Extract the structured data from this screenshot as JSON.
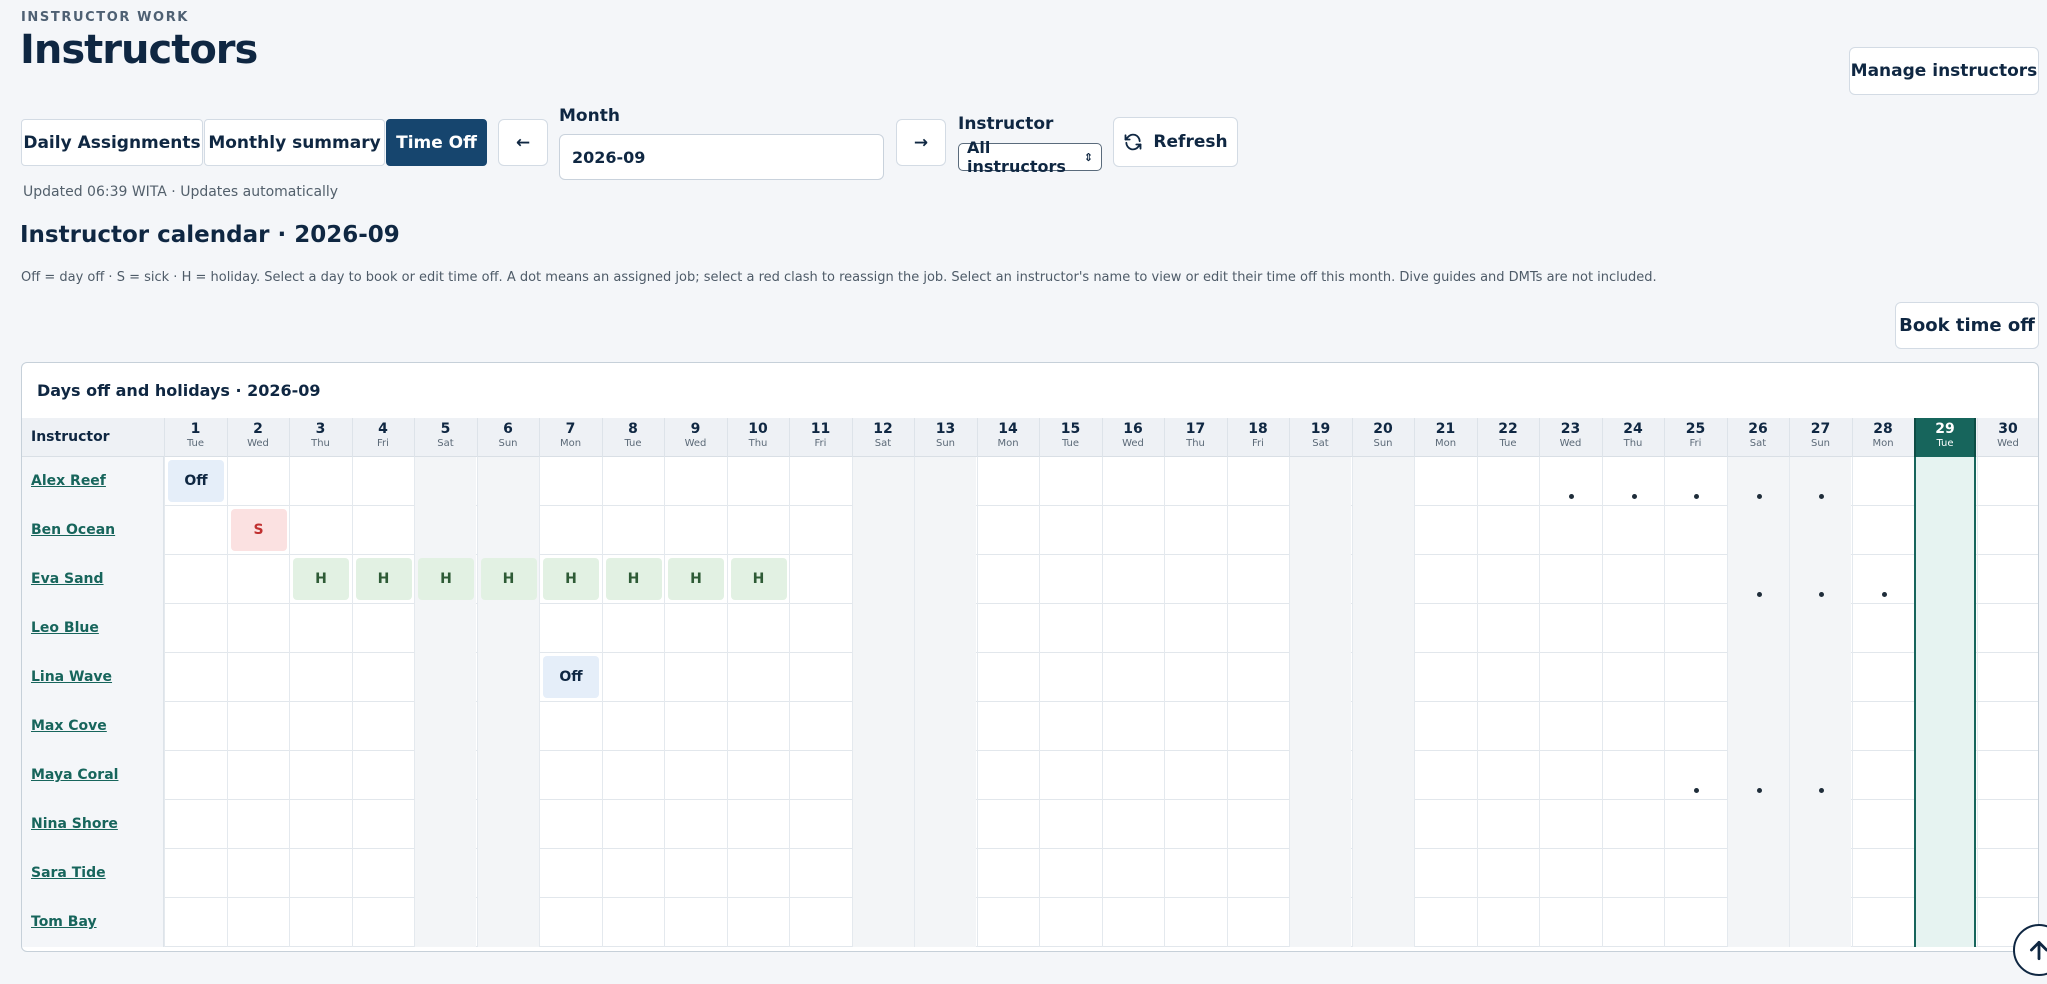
{
  "header": {
    "eyebrow": "INSTRUCTOR WORK",
    "title": "Instructors",
    "manage_label": "Manage instructors"
  },
  "tabs": [
    {
      "label": "Daily Assignments",
      "active": false
    },
    {
      "label": "Monthly summary",
      "active": false
    },
    {
      "label": "Time Off",
      "active": true
    }
  ],
  "controls": {
    "prev_label": "←",
    "next_label": "→",
    "month_label": "Month",
    "month_value": "2026-09",
    "instructor_label": "Instructor",
    "instructor_value": "All instructors",
    "refresh_label": "Refresh"
  },
  "updated_text": "Updated 06:39 WITA · Updates automatically",
  "calendar_title": "Instructor calendar · 2026-09",
  "legend_text": "Off = day off · S = sick · H = holiday. Select a day to book or edit time off. A dot means an assigned job; select a red clash to reassign the job. Select an instructor's name to view or edit their time off this month. Dive guides and DMTs are not included.",
  "book_label": "Book time off",
  "panel_title": "Days off and holidays · 2026-09",
  "column_header": "Instructor",
  "today": 29,
  "days": [
    {
      "n": "1",
      "w": "Tue"
    },
    {
      "n": "2",
      "w": "Wed"
    },
    {
      "n": "3",
      "w": "Thu"
    },
    {
      "n": "4",
      "w": "Fri"
    },
    {
      "n": "5",
      "w": "Sat"
    },
    {
      "n": "6",
      "w": "Sun"
    },
    {
      "n": "7",
      "w": "Mon"
    },
    {
      "n": "8",
      "w": "Tue"
    },
    {
      "n": "9",
      "w": "Wed"
    },
    {
      "n": "10",
      "w": "Thu"
    },
    {
      "n": "11",
      "w": "Fri"
    },
    {
      "n": "12",
      "w": "Sat"
    },
    {
      "n": "13",
      "w": "Sun"
    },
    {
      "n": "14",
      "w": "Mon"
    },
    {
      "n": "15",
      "w": "Tue"
    },
    {
      "n": "16",
      "w": "Wed"
    },
    {
      "n": "17",
      "w": "Thu"
    },
    {
      "n": "18",
      "w": "Fri"
    },
    {
      "n": "19",
      "w": "Sat"
    },
    {
      "n": "20",
      "w": "Sun"
    },
    {
      "n": "21",
      "w": "Mon"
    },
    {
      "n": "22",
      "w": "Tue"
    },
    {
      "n": "23",
      "w": "Wed"
    },
    {
      "n": "24",
      "w": "Thu"
    },
    {
      "n": "25",
      "w": "Fri"
    },
    {
      "n": "26",
      "w": "Sat"
    },
    {
      "n": "27",
      "w": "Sun"
    },
    {
      "n": "28",
      "w": "Mon"
    },
    {
      "n": "29",
      "w": "Tue"
    },
    {
      "n": "30",
      "w": "Wed"
    }
  ],
  "weekend_days": [
    5,
    6,
    12,
    13,
    19,
    20,
    26,
    27
  ],
  "instructors": [
    {
      "name": "Alex Reef",
      "entries": {
        "1": "Off"
      },
      "jobs": [
        23,
        24,
        25,
        26,
        27
      ]
    },
    {
      "name": "Ben Ocean",
      "entries": {
        "2": "S"
      },
      "jobs": []
    },
    {
      "name": "Eva Sand",
      "entries": {
        "3": "H",
        "4": "H",
        "5": "H",
        "6": "H",
        "7": "H",
        "8": "H",
        "9": "H",
        "10": "H"
      },
      "jobs": [
        26,
        27,
        28
      ]
    },
    {
      "name": "Leo Blue",
      "entries": {},
      "jobs": []
    },
    {
      "name": "Lina Wave",
      "entries": {
        "7": "Off"
      },
      "jobs": []
    },
    {
      "name": "Max Cove",
      "entries": {},
      "jobs": []
    },
    {
      "name": "Maya Coral",
      "entries": {},
      "jobs": [
        25,
        26,
        27
      ]
    },
    {
      "name": "Nina Shore",
      "entries": {},
      "jobs": []
    },
    {
      "name": "Sara Tide",
      "entries": {},
      "jobs": []
    },
    {
      "name": "Tom Bay",
      "entries": {},
      "jobs": []
    }
  ],
  "icons": {
    "refresh": "refresh-icon",
    "scroll_top": "arrow-up-icon",
    "select_caret": "updown-caret-icon"
  },
  "colors": {
    "primary": "#16456e",
    "today": "#17655c",
    "off": "#e5eef9",
    "sick": "#fbe1e1",
    "holiday": "#e2f1e3"
  }
}
